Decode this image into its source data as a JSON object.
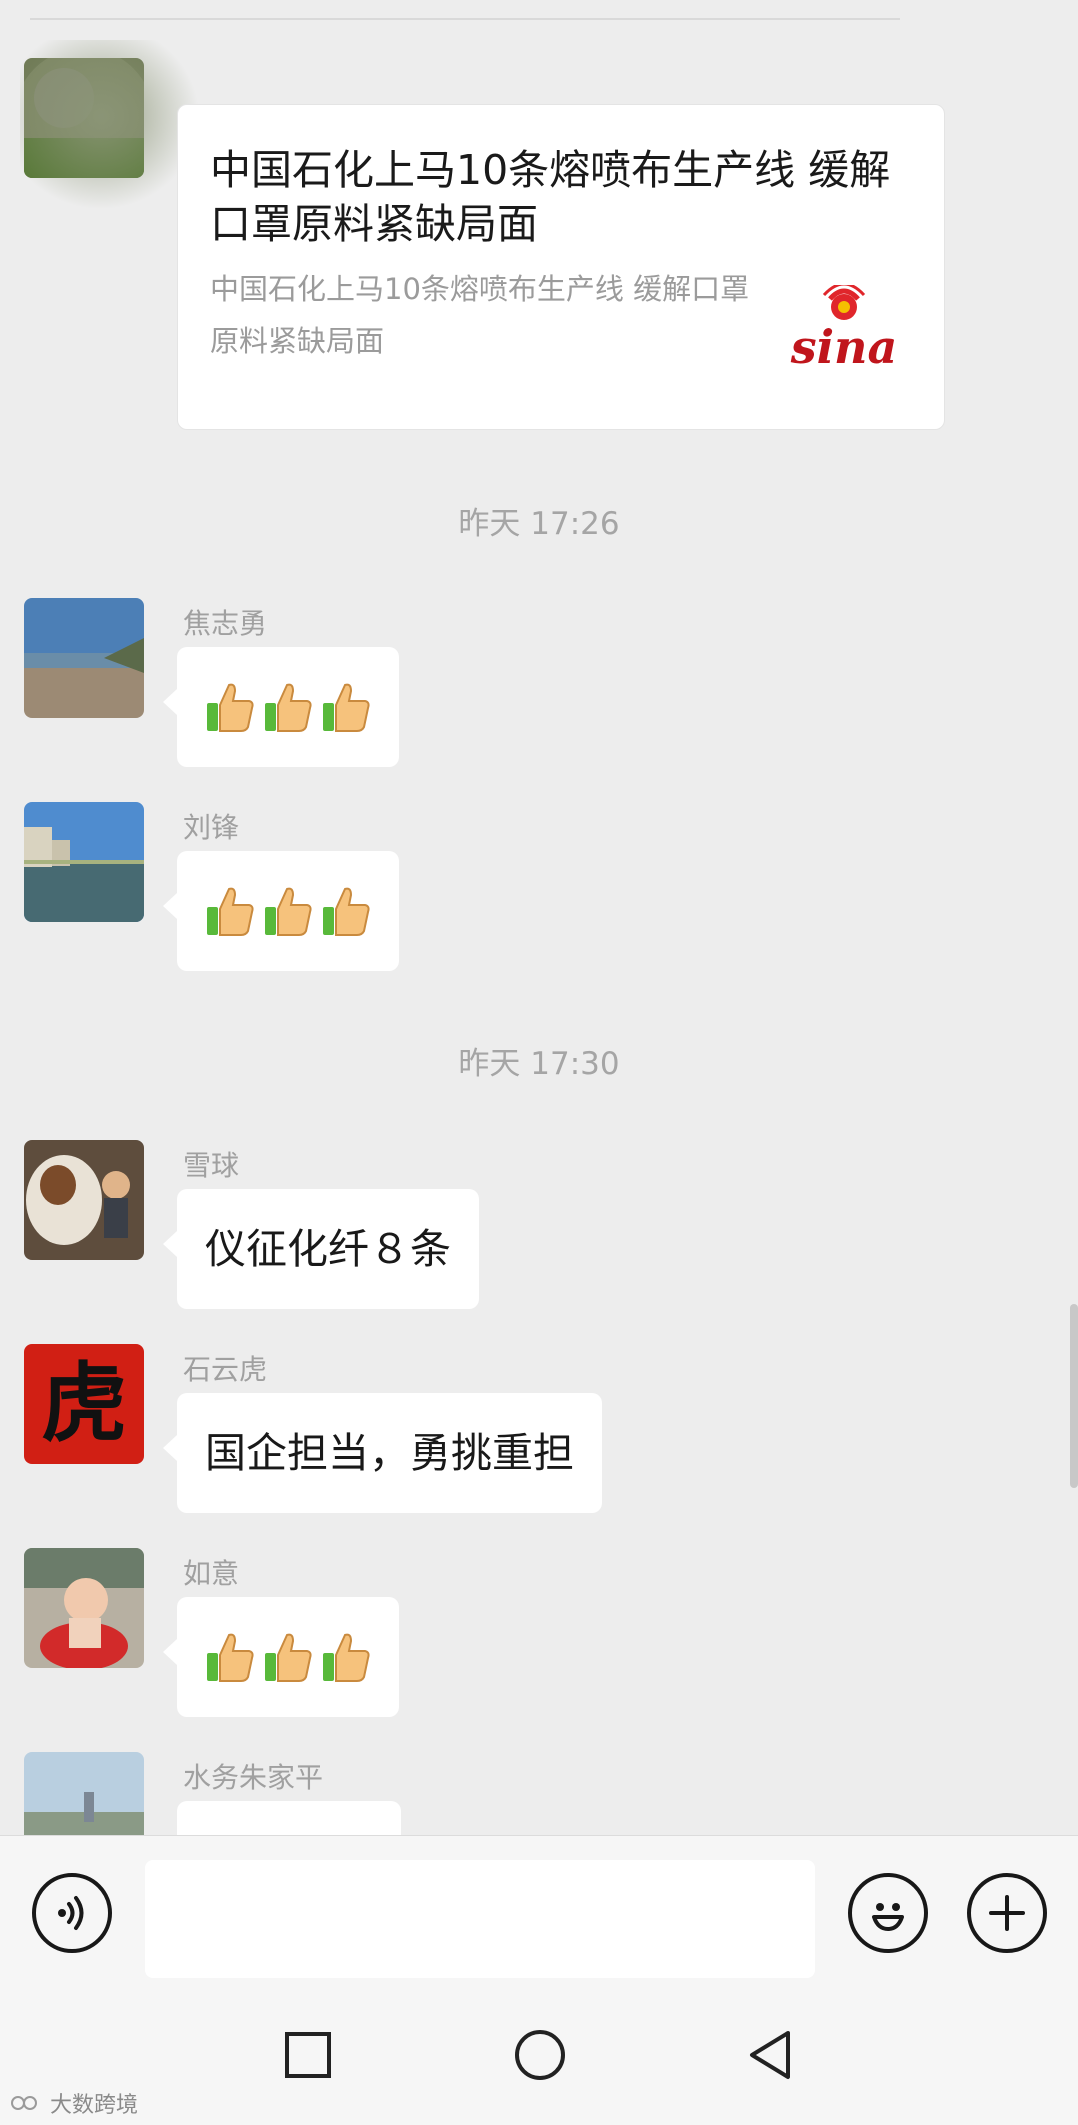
{
  "link_card": {
    "title": "中国石化上马10条熔喷布生产线 缓解口罩原料紧缺局面",
    "description": "中国石化上马10条熔喷布生产线 缓解口罩原料紧缺局面",
    "source_logo": "sina"
  },
  "timestamps": [
    "昨天 17:26",
    "昨天 17:30"
  ],
  "messages": [
    {
      "sender": "焦志勇",
      "content": "👍👍👍"
    },
    {
      "sender": "刘锋",
      "content": "👍👍👍"
    },
    {
      "sender": "雪球",
      "content": "仪征化纤８条"
    },
    {
      "sender": "石云虎",
      "content": "国企担当，勇挑重担"
    },
    {
      "sender": "如意",
      "content": "👍👍👍"
    },
    {
      "sender": "水务朱家平",
      "content": ""
    }
  ],
  "avatar_glyph": "虎",
  "input_bar": {
    "voice_icon": "voice-icon",
    "emoji_icon": "emoji-icon",
    "plus_icon": "plus-icon",
    "message_placeholder": ""
  },
  "nav": [
    "recent-apps-icon",
    "home-icon",
    "back-icon"
  ],
  "watermark": "大数跨境"
}
